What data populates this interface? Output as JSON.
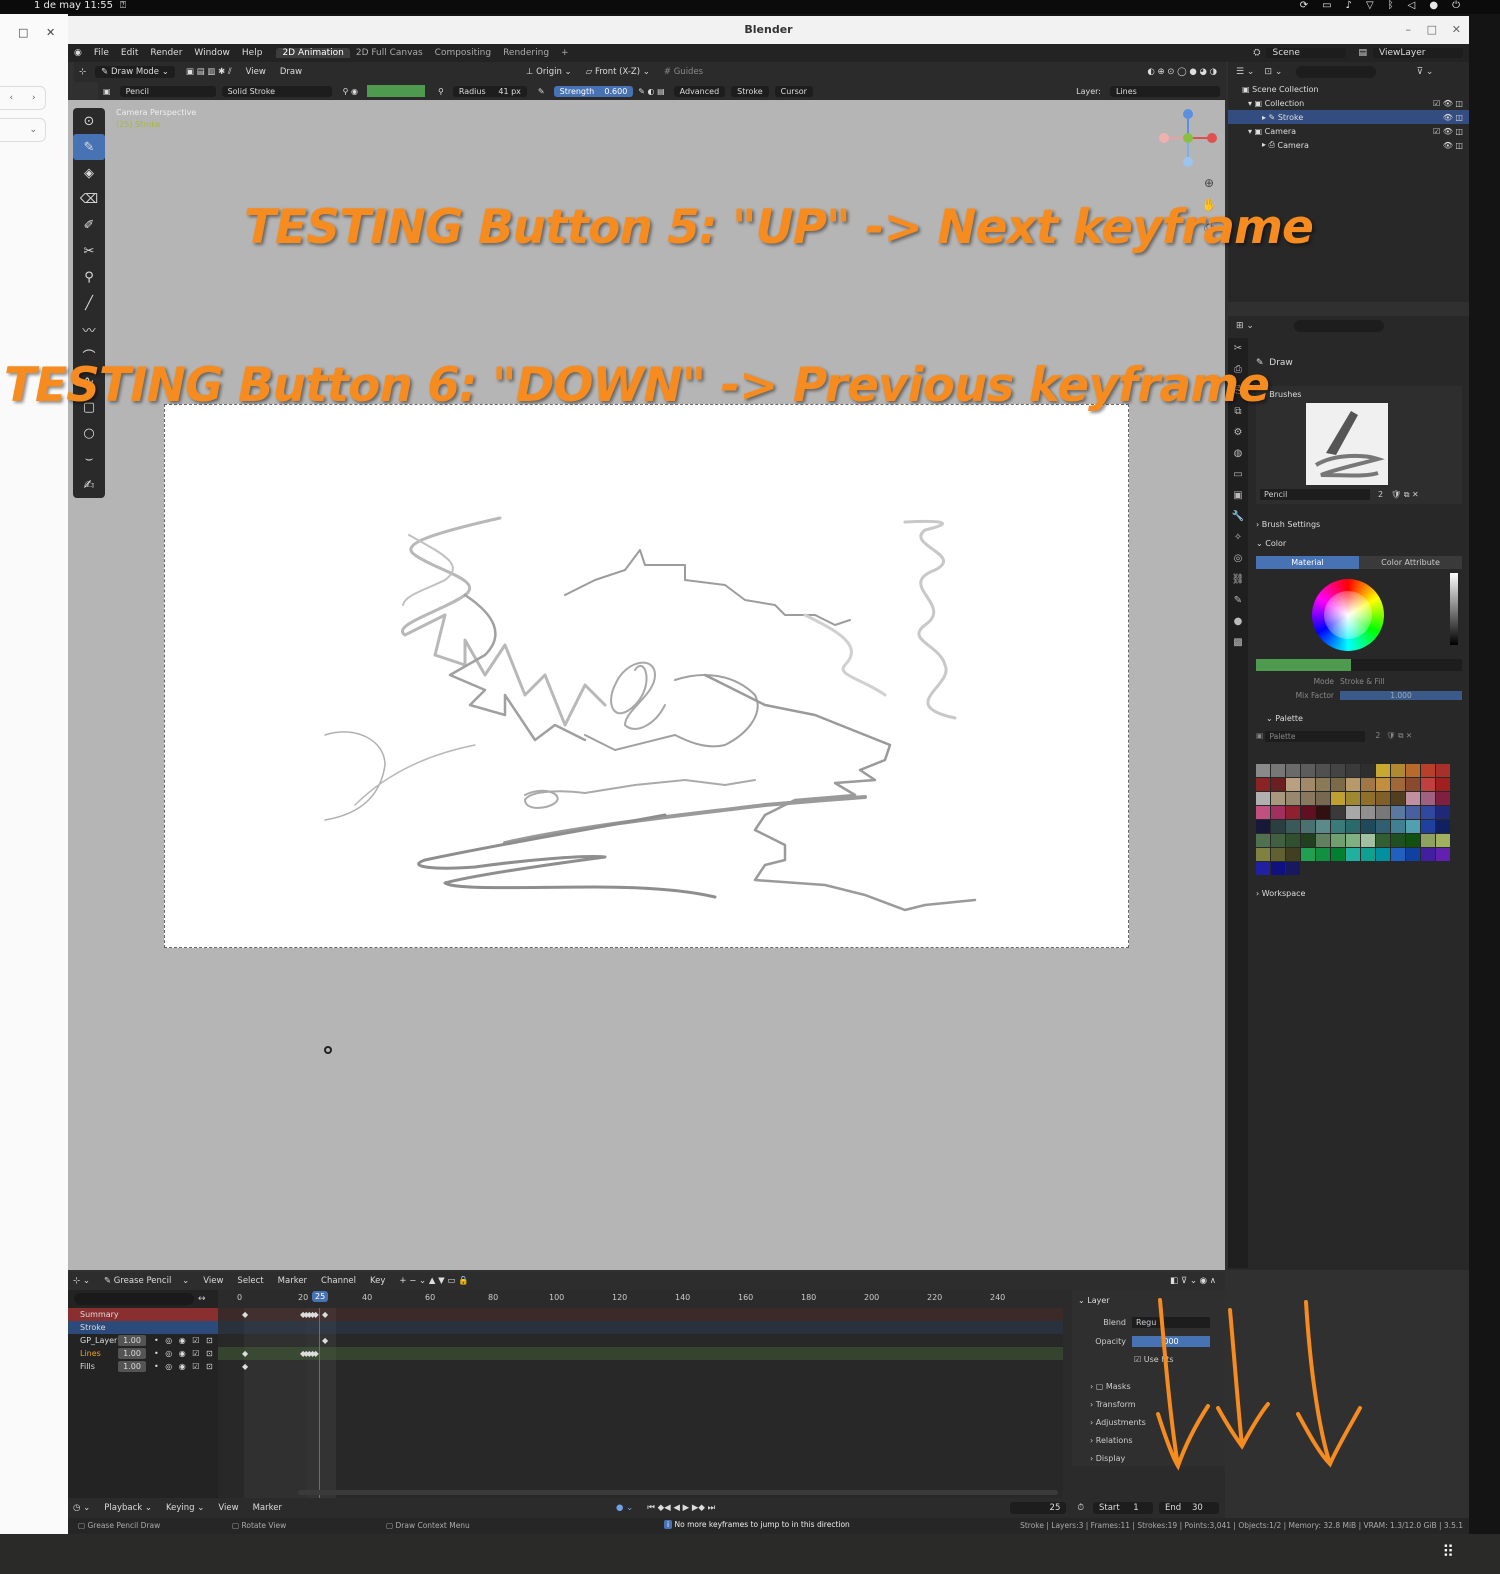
{
  "system": {
    "datetime": "1 de may 11:55"
  },
  "left_window": {
    "restore_icon": "□",
    "close_icon": "✕",
    "back_icon": "‹",
    "forward_icon": "›",
    "dropdown_icon": "⌄"
  },
  "window": {
    "title": "Blender"
  },
  "menu": {
    "items": [
      "File",
      "Edit",
      "Render",
      "Window",
      "Help"
    ],
    "workspaces": [
      "2D Animation",
      "2D Full Canvas",
      "Compositing",
      "Rendering"
    ],
    "active_workspace": "2D Animation",
    "add_tab": "+",
    "scene": "Scene",
    "view_layer": "ViewLayer"
  },
  "viewport_header": {
    "mode": "Draw Mode",
    "view": "View",
    "draw": "Draw",
    "origin": "Origin",
    "projection": "Front (X-Z)",
    "guides": "Guides"
  },
  "tool_settings": {
    "brush": "Pencil",
    "material": "Solid Stroke",
    "radius_label": "Radius",
    "radius_value": "41 px",
    "strength_label": "Strength",
    "strength_value": "0.600",
    "advanced": "Advanced",
    "stroke": "Stroke",
    "cursor": "Cursor",
    "layer_label": "Layer:",
    "layer_value": "Lines"
  },
  "viewport": {
    "camera_text": "Camera Perspective",
    "object_text": "(25) Stroke",
    "overlay_line1": "TESTING Button 5: \"UP\" -> Next keyframe",
    "overlay_line2": "TESTING Button 6: \"DOWN\" -> Previous  keyframe"
  },
  "outliner": {
    "rows": [
      {
        "label": "Scene Collection",
        "indent": 0,
        "selected": false
      },
      {
        "label": "Collection",
        "indent": 1,
        "selected": false
      },
      {
        "label": "Stroke",
        "indent": 2,
        "selected": true
      },
      {
        "label": "Camera",
        "indent": 1,
        "selected": false
      },
      {
        "label": "Camera",
        "indent": 2,
        "selected": false
      }
    ]
  },
  "properties": {
    "tool_title": "Draw",
    "brushes_label": "Brushes",
    "brush_name": "Pencil",
    "brush_users": "2",
    "brush_settings": "Brush Settings",
    "color": "Color",
    "tabs": [
      "Material",
      "Color Attribute"
    ],
    "mode_label": "Mode",
    "mode_value": "Stroke & Fill",
    "mix_factor_label": "Mix Factor",
    "mix_factor_value": "1.000",
    "palette_label": "Palette",
    "palette_name": "Palette",
    "palette_users": "2",
    "workspace": "Workspace",
    "palette_colors": [
      "#8a8a8a",
      "#777777",
      "#6a6a6a",
      "#5c5c5c",
      "#505050",
      "#444444",
      "#3a3a3a",
      "#2e2e2e",
      "#c8a82e",
      "#b08a2e",
      "#b86a2a",
      "#b8402a",
      "#a8302a",
      "#8a2424",
      "#6a2020",
      "#b8a080",
      "#a08a6a",
      "#8a7a58",
      "#7a6a48",
      "#b89a6a",
      "#a07848",
      "#c09040",
      "#a06838",
      "#8a4a30",
      "#c04040",
      "#a02020",
      "#b0b0b0",
      "#a89880",
      "#988870",
      "#887860",
      "#786850",
      "#c0a030",
      "#a08830",
      "#907028",
      "#806028",
      "#504020",
      "#c090a0",
      "#a06080",
      "#802040",
      "#c05080",
      "#a03060",
      "#902030",
      "#601020",
      "#301010",
      "#3a3a3a",
      "#a8a8a8",
      "#909090",
      "#787878",
      "#5a78a0",
      "#4860a0",
      "#3048a0",
      "#202878",
      "#181838",
      "#2a4040",
      "#3a5a5a",
      "#4a7070",
      "#5a8a8a",
      "#3a7a7a",
      "#2a6a6a",
      "#204a5a",
      "#306070",
      "#408090",
      "#50a0b0",
      "#2040a0",
      "#102060",
      "#507050",
      "#406040",
      "#305030",
      "#204020",
      "#608060",
      "#70a070",
      "#80b080",
      "#a0c0a0",
      "#306030",
      "#205020",
      "#105010",
      "#90a060",
      "#a0b060",
      "#808040",
      "#606030",
      "#404020",
      "#20a050",
      "#109040",
      "#008030",
      "#20b0a0",
      "#10a090",
      "#0090a0",
      "#2060c0",
      "#1040a0",
      "#4020a0",
      "#6020b0",
      "#2020a0",
      "#101080",
      "#181860"
    ]
  },
  "dopesheet": {
    "editor": "Grease Pencil",
    "menus": [
      "View",
      "Select",
      "Marker",
      "Channel",
      "Key"
    ],
    "ruler": [
      "0",
      "20",
      "25",
      "40",
      "60",
      "80",
      "100",
      "120",
      "140",
      "160",
      "180",
      "200",
      "220",
      "240"
    ],
    "current_frame": "25",
    "channels": [
      {
        "name": "Summary",
        "value": "",
        "kind": "summary"
      },
      {
        "name": "Stroke",
        "value": "",
        "kind": "object"
      },
      {
        "name": "GP_Layer",
        "value": "1.00",
        "kind": "layer"
      },
      {
        "name": "Lines",
        "value": "1.00",
        "kind": "layer-active"
      },
      {
        "name": "Fills",
        "value": "1.00",
        "kind": "layer"
      }
    ],
    "side_panel": {
      "title": "Layer",
      "blend_label": "Blend",
      "blend_value": "Regu",
      "opacity_label": "Opacity",
      "opacity_value": "000",
      "use_lights": "Use    hts",
      "sections": [
        "Masks",
        "Transform",
        "Adjustments",
        "Relations",
        "Display"
      ]
    }
  },
  "timeline": {
    "menus": [
      "Playback",
      "Keying",
      "View",
      "Marker"
    ],
    "frame": "25",
    "start_label": "Start",
    "start_value": "1",
    "end_label": "End",
    "end_value": "30"
  },
  "statusbar": {
    "left1": "Grease Pencil Draw",
    "left2": "Rotate View",
    "left3": "Draw Context Menu",
    "message": "No more keyframes to jump to in this direction",
    "stats": "Stroke | Layers:3 | Frames:11 | Strokes:19 | Points:3,041 | Objects:1/2 | Memory: 32.8 MiB | VRAM: 1.3/12.0 GiB | 3.5.1"
  }
}
